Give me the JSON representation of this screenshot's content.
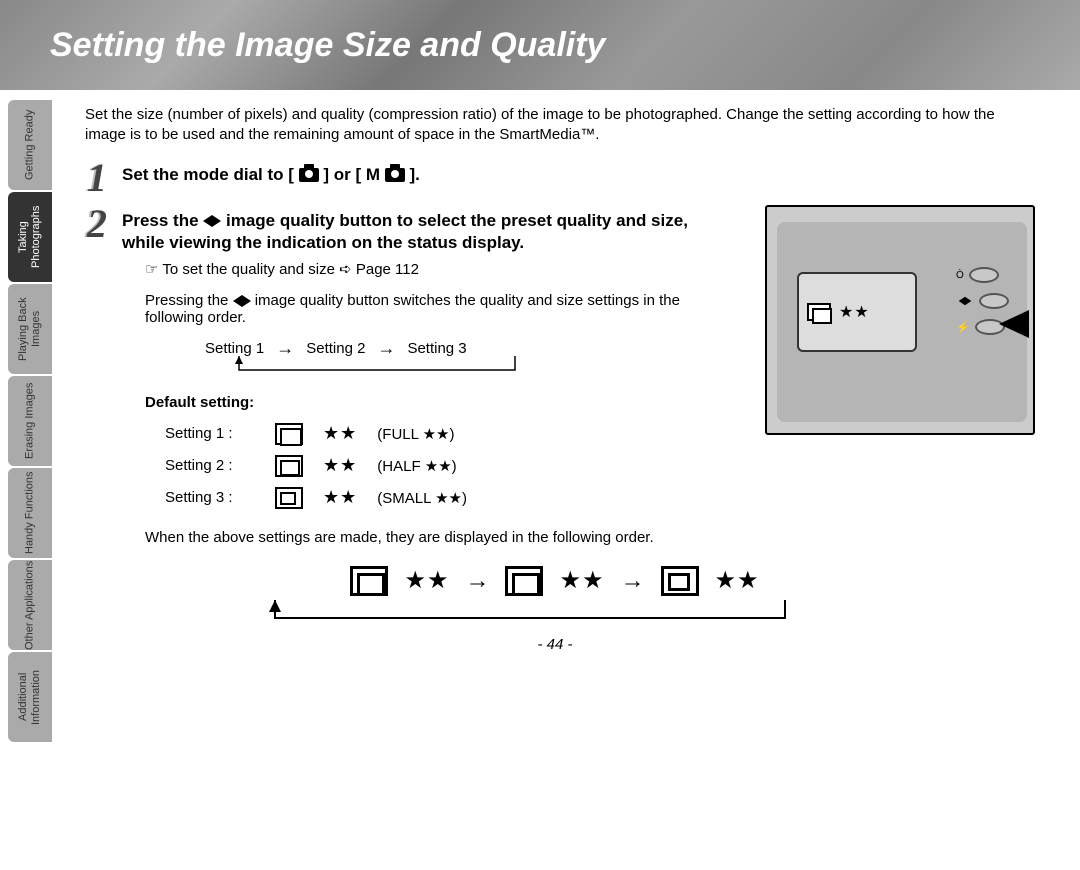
{
  "header": {
    "title": "Setting the Image Size and Quality"
  },
  "tabs": [
    {
      "label": "Getting\nReady",
      "active": false
    },
    {
      "label": "Taking\nPhotographs",
      "active": true
    },
    {
      "label": "Playing\nBack Images",
      "active": false
    },
    {
      "label": "Erasing\nImages",
      "active": false
    },
    {
      "label": "Handy\nFunctions",
      "active": false
    },
    {
      "label": "Other\nApplications",
      "active": false
    },
    {
      "label": "Additional\nInformation",
      "active": false
    }
  ],
  "intro": "Set the size (number of pixels) and quality (compression ratio) of the image to be photographed. Change the setting according to how the image is to be used and the remaining amount of space in the SmartMedia™.",
  "step1": {
    "before": "Set the mode dial to [ ",
    "mid": " ] or [ M",
    "after": " ]."
  },
  "step2": "Press the ↔ image quality button to select the preset quality and size, while viewing the indication on the status display.",
  "note": "☞ To set the quality and size ➪ Page 112",
  "para_after_note": "Pressing the ↔ image quality button switches the quality and size settings in the following order.",
  "flow": {
    "a": "Setting 1",
    "b": "Setting 2",
    "c": "Setting 3"
  },
  "default_heading": "Default setting:",
  "settings": [
    {
      "label": "Setting 1 :",
      "stars": "★★",
      "desc": "(FULL ★★)"
    },
    {
      "label": "Setting 2 :",
      "stars": "★★",
      "desc": "(HALF ★★)"
    },
    {
      "label": "Setting 3 :",
      "stars": "★★",
      "desc": "(SMALL ★★)"
    }
  ],
  "para_after_settings": "When the above settings are made, they are displayed in the following order.",
  "camera_lcd_stars": "★★",
  "camera_btn_icons": [
    "⏱",
    "🌀",
    "⚡"
  ],
  "page_number": "- 44 -"
}
